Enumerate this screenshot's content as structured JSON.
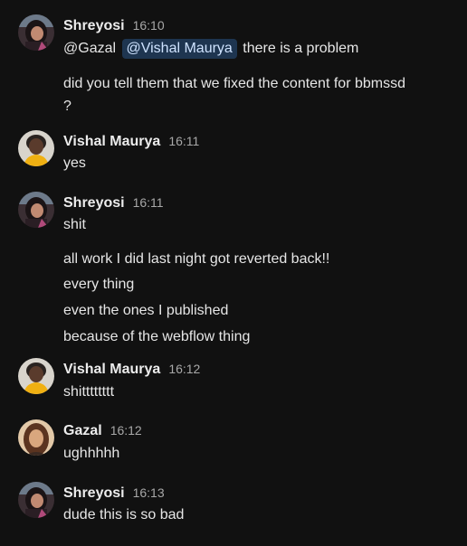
{
  "messages": [
    {
      "author": "Shreyosi",
      "time": "16:10",
      "avatar": "shreyosi-avatar",
      "lines": [
        {
          "mention1": "@Gazal",
          "mention2": "@Vishal Maurya",
          "text": "there is a problem"
        },
        {
          "text": "did you tell them that we fixed the content for bbmssd"
        },
        {
          "text": "?"
        }
      ]
    },
    {
      "author": "Vishal Maurya",
      "time": "16:11",
      "avatar": "vishal-avatar",
      "lines": [
        {
          "text": "yes"
        }
      ]
    },
    {
      "author": "Shreyosi",
      "time": "16:11",
      "avatar": "shreyosi-avatar",
      "lines": [
        {
          "text": "shit"
        },
        {
          "text": "all work I did last night got reverted back!!"
        },
        {
          "text": "every thing"
        },
        {
          "text": "even the ones I published"
        },
        {
          "text": "because of the webflow thing"
        }
      ]
    },
    {
      "author": "Vishal Maurya",
      "time": "16:12",
      "avatar": "vishal-avatar",
      "lines": [
        {
          "text": "shitttttttt"
        }
      ]
    },
    {
      "author": "Gazal",
      "time": "16:12",
      "avatar": "gazal-avatar",
      "lines": [
        {
          "text": "ughhhhh"
        }
      ]
    },
    {
      "author": "Shreyosi",
      "time": "16:13",
      "avatar": "shreyosi-avatar",
      "lines": [
        {
          "text": "dude this is so bad"
        }
      ]
    }
  ],
  "colors": {
    "background": "#111111",
    "mention_chip_bg": "#1e3550",
    "mention_chip_text": "#cfe3ff",
    "timestamp": "#a8a8a8"
  }
}
